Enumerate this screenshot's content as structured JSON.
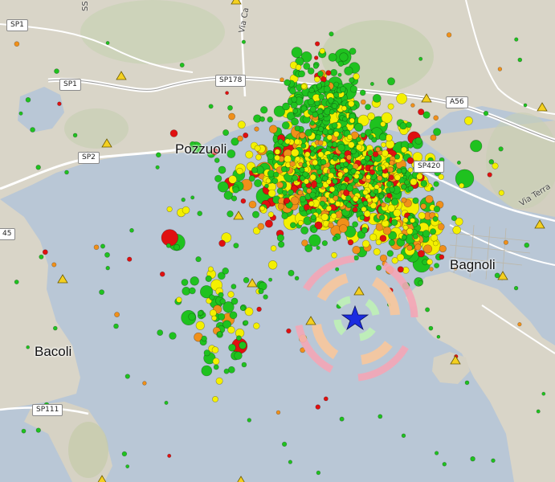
{
  "map": {
    "place_labels": [
      {
        "id": "pozzuoli",
        "text": "Pozzuoli"
      },
      {
        "id": "bagnoli",
        "text": "Bagnoli"
      },
      {
        "id": "bacoli",
        "text": "Bacoli"
      }
    ],
    "road_labels": [
      {
        "id": "sp1-a",
        "text": "SP1"
      },
      {
        "id": "sp1-b",
        "text": "SP1"
      },
      {
        "id": "sp178",
        "text": "SP178"
      },
      {
        "id": "sp2",
        "text": "SP2"
      },
      {
        "id": "a56",
        "text": "A56"
      },
      {
        "id": "sp420",
        "text": "SP420"
      },
      {
        "id": "sp111",
        "text": "SP111"
      },
      {
        "id": "cut-45",
        "text": "45"
      }
    ],
    "street_labels": [
      {
        "id": "via-ca",
        "text": "Via Ca"
      },
      {
        "id": "via-terra",
        "text": "Via Terra"
      },
      {
        "id": "ss",
        "text": "SS"
      }
    ],
    "colors": {
      "sea": "#b9c7d6",
      "land": "#d9d5c8",
      "motorway": "#ffffff",
      "event_green": "#1fc21f",
      "event_yellow": "#f4f000",
      "event_orange": "#f0901a",
      "event_red": "#e01010",
      "epicenter_star": "#1a2be0",
      "ring_outer": "#f4a6b6",
      "ring_middle": "#f6c8a0",
      "ring_inner": "#bff0b8",
      "station_triangle": "#f4d020"
    },
    "event_color_classes": [
      "green",
      "yellow",
      "orange",
      "red"
    ],
    "epicenter_icon": "star-icon",
    "station_icon": "triangle-icon"
  }
}
